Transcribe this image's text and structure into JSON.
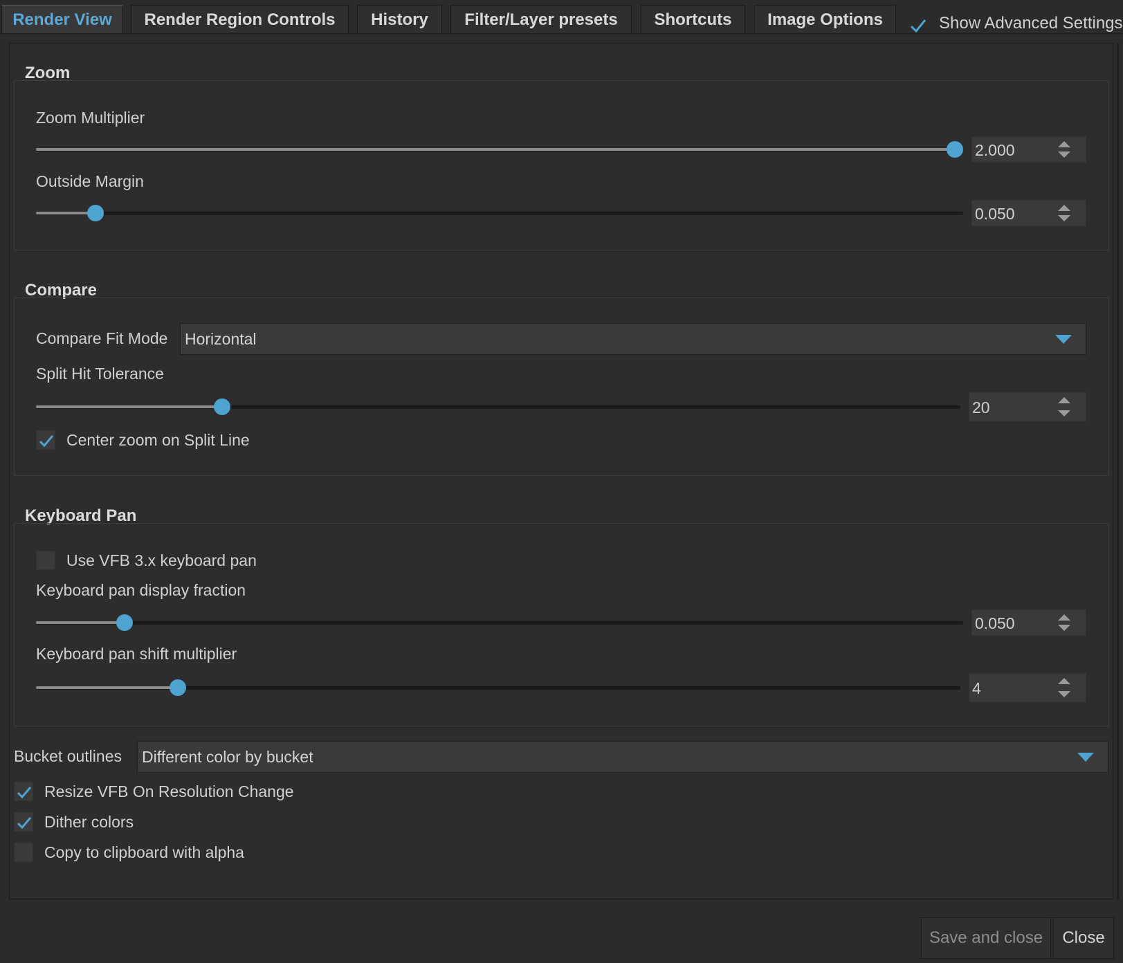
{
  "tabs": [
    {
      "label": "Render View",
      "active": true
    },
    {
      "label": "Render Region Controls",
      "active": false
    },
    {
      "label": "History",
      "active": false
    },
    {
      "label": "Filter/Layer presets",
      "active": false
    },
    {
      "label": "Shortcuts",
      "active": false
    },
    {
      "label": "Image Options",
      "active": false
    }
  ],
  "show_advanced": {
    "label": "Show Advanced Settings",
    "checked": true
  },
  "zoom": {
    "title": "Zoom",
    "multiplier": {
      "label": "Zoom Multiplier",
      "value": "2.000",
      "fraction": 1.0
    },
    "outside_margin": {
      "label": "Outside Margin",
      "value": "0.050",
      "fraction": 0.056
    }
  },
  "compare": {
    "title": "Compare",
    "fit_mode": {
      "label": "Compare Fit Mode",
      "value": "Horizontal"
    },
    "split_tolerance": {
      "label": "Split Hit Tolerance",
      "value": "20",
      "fraction": 0.196
    },
    "center_zoom": {
      "label": "Center zoom on Split Line",
      "checked": true
    }
  },
  "keyboard_pan": {
    "title": "Keyboard Pan",
    "use_vfb3": {
      "label": "Use VFB 3.x keyboard pan",
      "checked": false
    },
    "display_fraction": {
      "label": "Keyboard pan display fraction",
      "value": "0.050",
      "fraction": 0.088
    },
    "shift_multiplier": {
      "label": "Keyboard pan shift multiplier",
      "value": "4",
      "fraction": 0.147
    }
  },
  "bucket_outlines": {
    "label": "Bucket outlines",
    "value": "Different color by bucket"
  },
  "options": [
    {
      "label": "Resize VFB On Resolution Change",
      "checked": true
    },
    {
      "label": "Dither colors",
      "checked": true
    },
    {
      "label": "Copy to clipboard with alpha",
      "checked": false
    }
  ],
  "buttons": {
    "save_close": "Save and close",
    "close": "Close"
  },
  "colors": {
    "accent": "#4fa3d1",
    "background": "#2b2b2b",
    "text": "#d0d0d0"
  }
}
